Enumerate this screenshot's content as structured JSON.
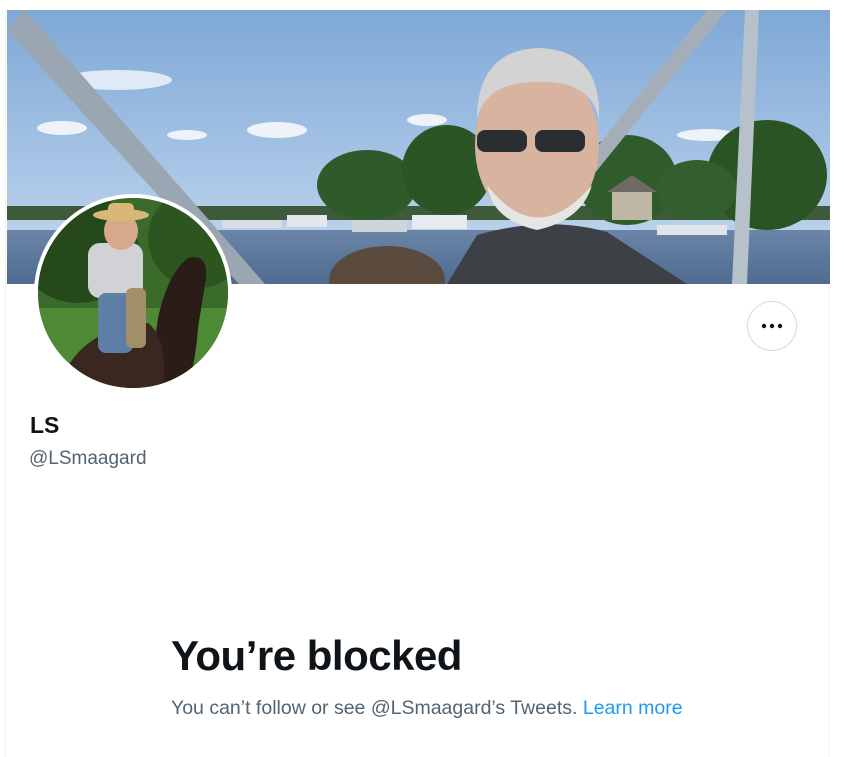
{
  "profile": {
    "display_name": "LS",
    "handle": "@LSmaagard",
    "more_icon": "more-horizontal-icon",
    "banner_image": "header-photo-man-on-pontoon-boat-lake",
    "avatar_image": "profile-photo-man-on-horse"
  },
  "blocked": {
    "title": "You’re blocked",
    "message": "You can’t follow or see @LSmaagard’s Tweets.",
    "link_label": "Learn more"
  },
  "colors": {
    "text_primary": "#0f1419",
    "text_secondary": "#536471",
    "link": "#1d9bf0",
    "border": "#cfd9de"
  }
}
